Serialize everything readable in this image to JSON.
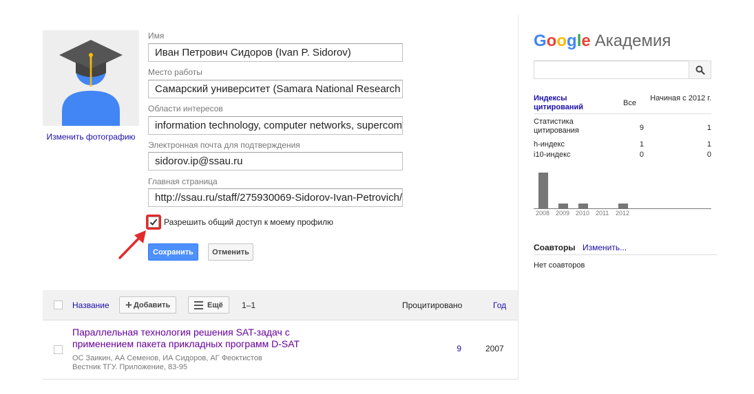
{
  "profile": {
    "change_photo_label": "Изменить фотографию",
    "fields": [
      {
        "label": "Имя",
        "value": "Иван Петрович Сидоров (Ivan P. Sidorov)"
      },
      {
        "label": "Место работы",
        "value": "Самарский университет (Samara National Research"
      },
      {
        "label": "Области интересов",
        "value": "information technology, computer networks, supercom"
      },
      {
        "label": "Электронная почта для подтверждения",
        "value": "sidorov.ip@ssau.ru"
      },
      {
        "label": "Главная страница",
        "value": "http://ssau.ru/staff/275930069-Sidorov-Ivan-Petrovich/"
      }
    ],
    "share_label": "Разрешить общий доступ к моему профилю",
    "share_checked": true,
    "save_label": "Сохранить",
    "cancel_label": "Отменить"
  },
  "articles": {
    "header": {
      "title_label": "Название",
      "add_label": "Добавить",
      "more_label": "Ещё",
      "range": "1–1",
      "cited_label": "Процитировано",
      "year_label": "Год"
    },
    "rows": [
      {
        "title": "Параллельная технология решения SAT-задач с применением пакета прикладных программ D-SAT",
        "authors": "ОС Заикин, АА Семенов, ИА Сидоров, АГ Феоктистов",
        "source": "Вестник ТГУ. Приложение, 83-95",
        "cited": "9",
        "year": "2007"
      }
    ]
  },
  "scholar": {
    "logo_google": "Google",
    "logo_rest": "Академия",
    "search_placeholder": "",
    "colors": {
      "blue": "#4285f4",
      "red": "#ea4335",
      "yellow": "#fbbc05",
      "green": "#34a853",
      "link": "#1a0dab",
      "visited": "#660099",
      "primary_button": "#4d90fe",
      "highlight": "#e32a2a"
    }
  },
  "citations": {
    "header_label": "Индексы цитирований",
    "header_all": "Все",
    "header_since": "Начиная с 2012 г.",
    "rows": [
      {
        "label": "Статистика цитирования",
        "all": "9",
        "since": "1"
      },
      {
        "label": "h-индекс",
        "all": "1",
        "since": "1"
      },
      {
        "label": "i10-индекс",
        "all": "0",
        "since": "0"
      }
    ]
  },
  "chart_data": {
    "type": "bar",
    "categories": [
      "2008",
      "2009",
      "2010",
      "2011",
      "2012"
    ],
    "values": [
      7,
      1,
      1,
      0,
      1
    ],
    "ylim": [
      0,
      7
    ],
    "grid": false
  },
  "coauthors": {
    "label": "Соавторы",
    "edit_label": "Изменить...",
    "empty_label": "Нет соавторов"
  },
  "icons": {
    "avatar": "graduate-avatar-icon",
    "search": "search-icon",
    "add": "plus-icon",
    "more": "menu-lines-icon",
    "check": "checkmark-icon",
    "arrow": "red-arrow-icon"
  }
}
